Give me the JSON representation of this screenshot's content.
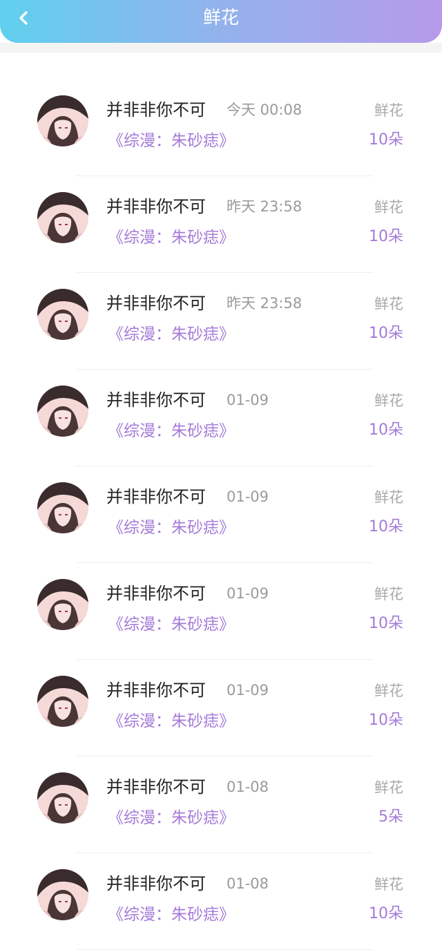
{
  "header": {
    "title": "鲜花",
    "colors": {
      "gradient_start": "#5fd0ee",
      "gradient_end": "#b69aea"
    },
    "back_icon": "chevron-left-icon"
  },
  "records": [
    {
      "user": "并非非你不可",
      "time": "今天 00:08",
      "book": "《综漫：朱砂痣》",
      "gift": "鲜花",
      "count": "10朵"
    },
    {
      "user": "并非非你不可",
      "time": "昨天 23:58",
      "book": "《综漫：朱砂痣》",
      "gift": "鲜花",
      "count": "10朵"
    },
    {
      "user": "并非非你不可",
      "time": "昨天 23:58",
      "book": "《综漫：朱砂痣》",
      "gift": "鲜花",
      "count": "10朵"
    },
    {
      "user": "并非非你不可",
      "time": "01-09",
      "book": "《综漫：朱砂痣》",
      "gift": "鲜花",
      "count": "10朵"
    },
    {
      "user": "并非非你不可",
      "time": "01-09",
      "book": "《综漫：朱砂痣》",
      "gift": "鲜花",
      "count": "10朵"
    },
    {
      "user": "并非非你不可",
      "time": "01-09",
      "book": "《综漫：朱砂痣》",
      "gift": "鲜花",
      "count": "10朵"
    },
    {
      "user": "并非非你不可",
      "time": "01-09",
      "book": "《综漫：朱砂痣》",
      "gift": "鲜花",
      "count": "10朵"
    },
    {
      "user": "并非非你不可",
      "time": "01-08",
      "book": "《综漫：朱砂痣》",
      "gift": "鲜花",
      "count": "5朵"
    },
    {
      "user": "并非非你不可",
      "time": "01-08",
      "book": "《综漫：朱砂痣》",
      "gift": "鲜花",
      "count": "10朵"
    }
  ]
}
